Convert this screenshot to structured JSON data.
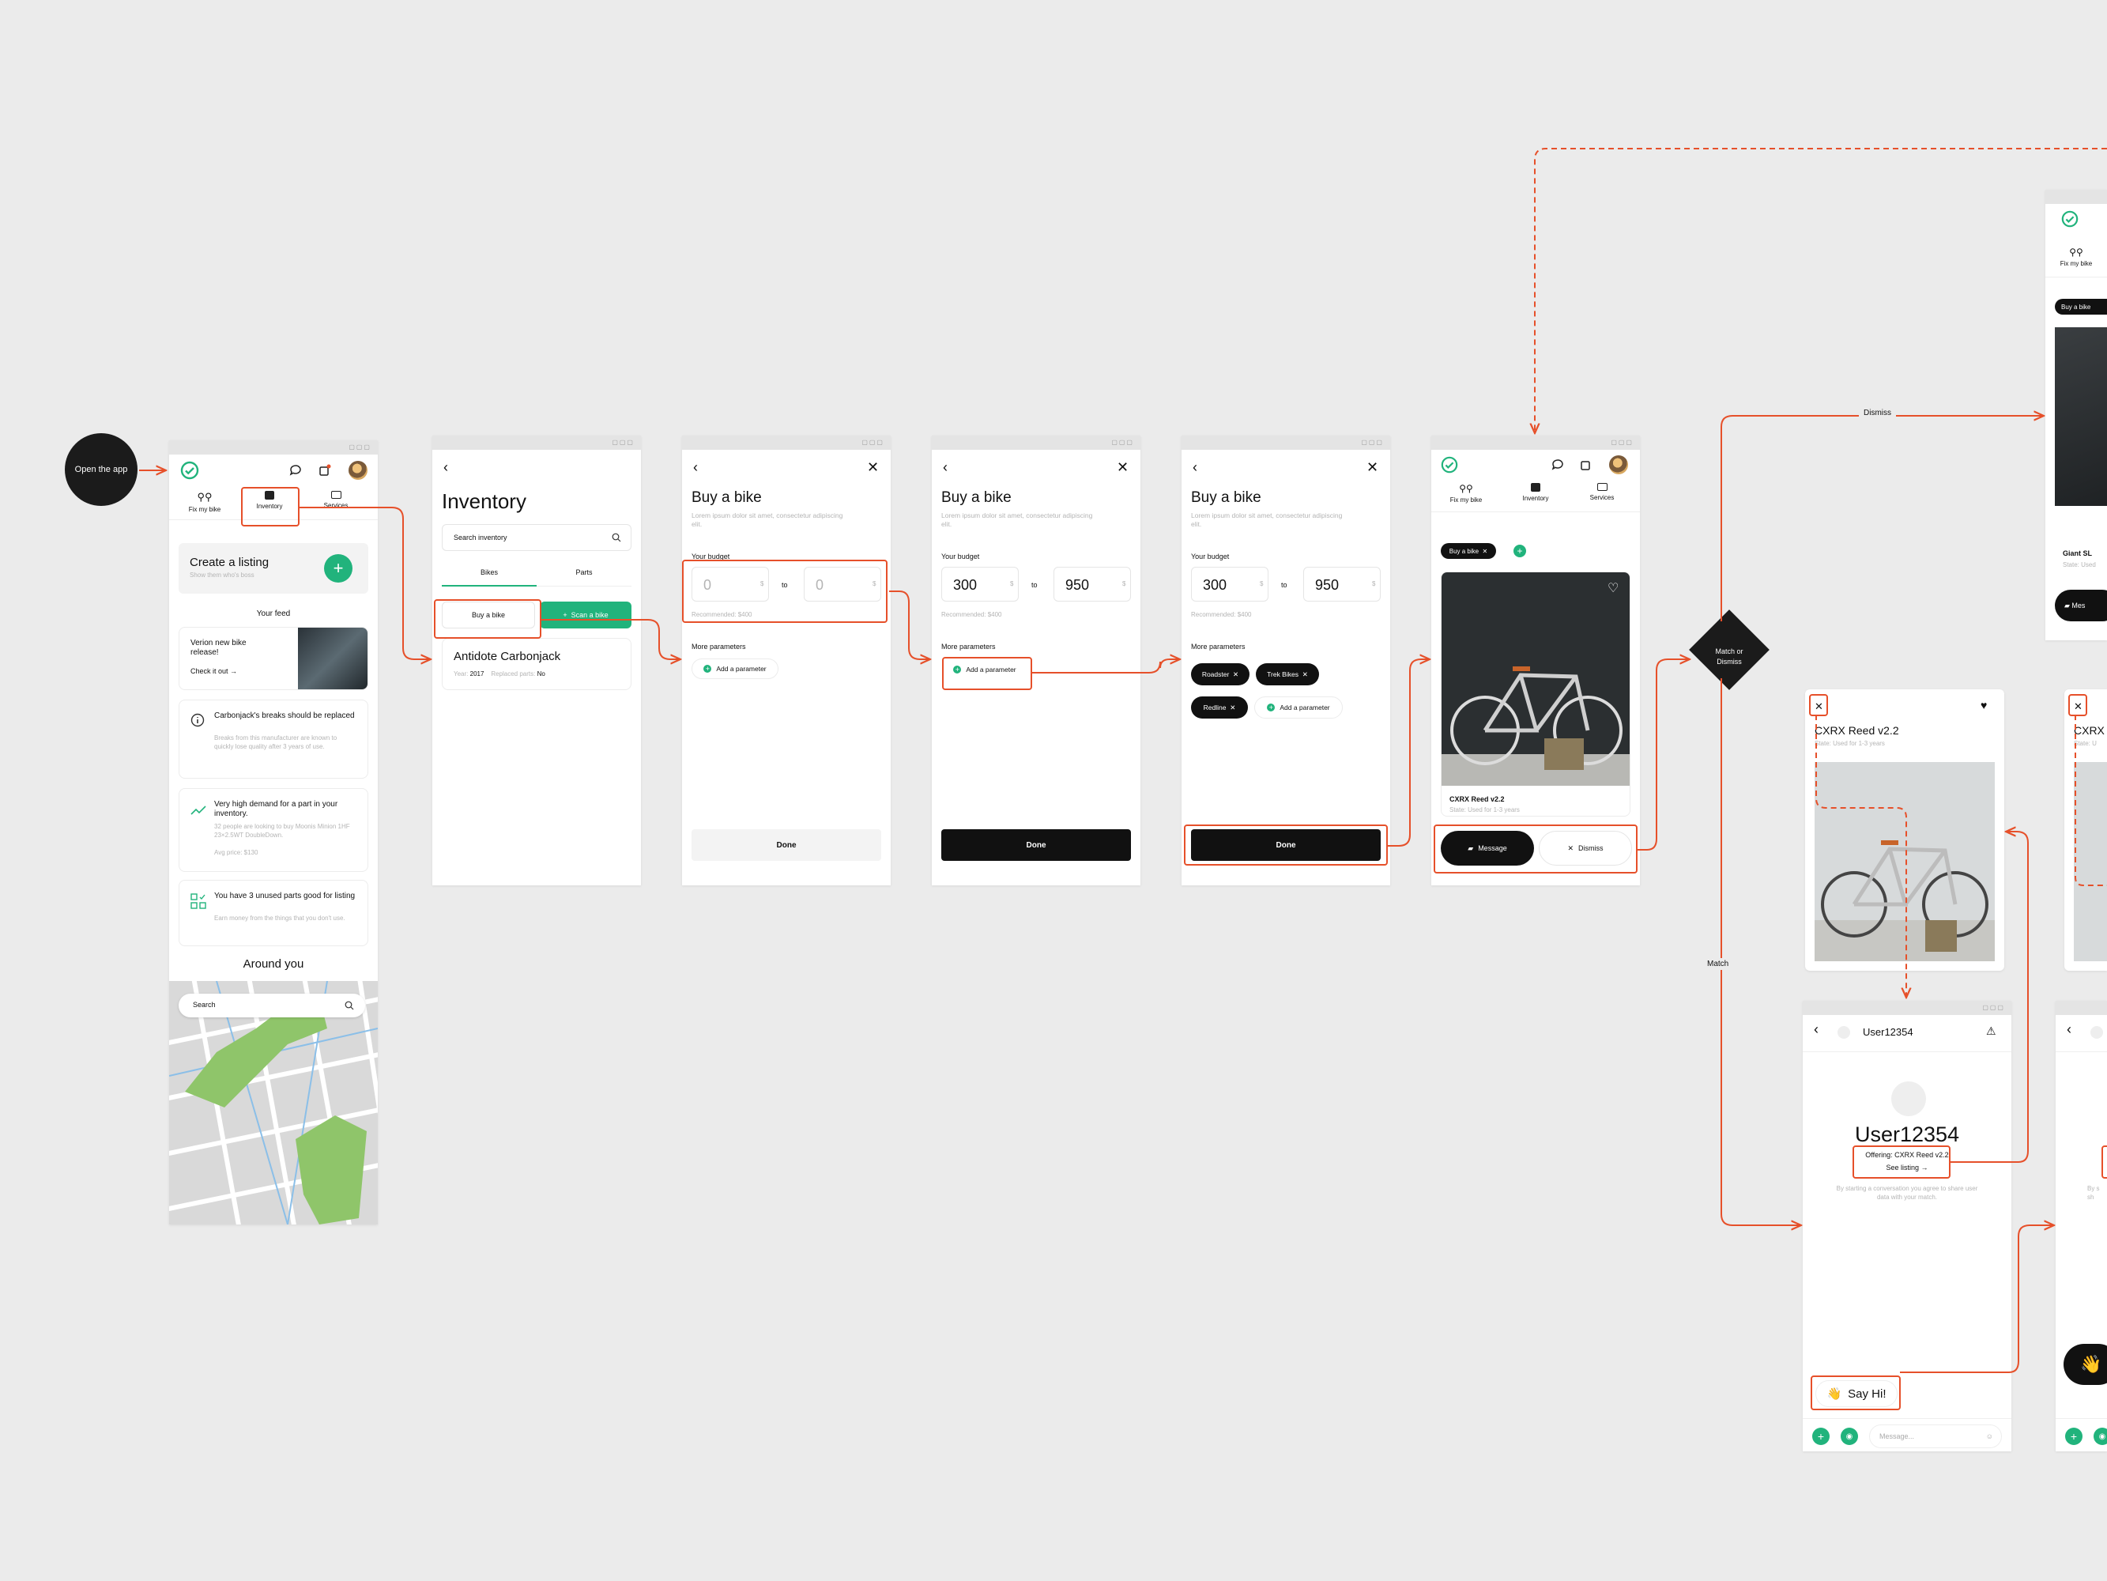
{
  "start": {
    "label": "Open the app"
  },
  "decision": {
    "label_1": "Match or",
    "label_2": "Dismiss"
  },
  "flow_labels": {
    "dismiss": "Dismiss",
    "match": "Match"
  },
  "home": {
    "nav": [
      "Fix my bike",
      "Inventory",
      "Services"
    ],
    "create": {
      "title": "Create a listing",
      "sub": "Show them who's boss"
    },
    "feed_title": "Your feed",
    "release": {
      "title": "Verion new bike release!",
      "link": "Check it out"
    },
    "feed": [
      {
        "title": "Carbonjack's breaks should be replaced",
        "body": "Breaks from this manufacturer are known to quickly lose quality after 3 years of use."
      },
      {
        "title": "Very high demand for a part in your inventory.",
        "body": "32 people are looking to buy Moonis Minion 1HF 23×2.5WT DoubleDown.",
        "extra": "Avg price: $130"
      },
      {
        "title": "You have 3 unused parts good for listing",
        "body": "Earn money from the things that you don't use."
      }
    ],
    "around_title": "Around you",
    "search": "Search"
  },
  "inventory": {
    "title": "Inventory",
    "search": "Search inventory",
    "tabs": [
      "Bikes",
      "Parts"
    ],
    "buy": "Buy a bike",
    "scan": "Scan a bike",
    "item": {
      "name": "Antidote Carbonjack",
      "year_label": "Year:",
      "year": "2017",
      "parts_label": "Replaced parts:",
      "parts": "No"
    }
  },
  "buy": {
    "title": "Buy a bike",
    "lorem": "Lorem ipsum dolor sit amet, consectetur adipiscing elit.",
    "budget_label": "Your budget",
    "to": "to",
    "currency": "$",
    "recommended": "Recommended: $400",
    "more": "More parameters",
    "add": "Add a parameter",
    "done": "Done",
    "empty_from": "0",
    "empty_to": "0",
    "from": "300",
    "to_val": "950",
    "tags": [
      "Roadster",
      "Trek Bikes",
      "Redline"
    ]
  },
  "results": {
    "nav": [
      "Fix my bike",
      "Inventory",
      "Services"
    ],
    "chip": "Buy a bike",
    "name": "CXRX Reed v2.2",
    "state": "State: Used for 1-3 years",
    "message": "Message",
    "dismiss": "Dismiss"
  },
  "partial": {
    "nav": "Fix my bike",
    "chip": "Buy a bike",
    "name": "Giant SL",
    "state": "State: Used",
    "message": "Mes"
  },
  "listing": {
    "name": "CXRX Reed v2.2",
    "state": "State: Used for 1-3 years"
  },
  "listing_partial": {
    "name": "CXRX",
    "state": "State: U"
  },
  "chat": {
    "user": "User12354",
    "offering": "Offering: CXRX Reed v2.2",
    "see": "See listing",
    "consent": "By starting a conversation you agree to share user data with your match.",
    "say_hi": "Say Hi!",
    "placeholder": "Message..."
  },
  "chat_partial": {
    "consent": "By s\nsh"
  },
  "colors": {
    "accent": "#21b37c",
    "annotation": "#e6502a",
    "dark": "#111111",
    "canvas": "#ebebeb"
  }
}
